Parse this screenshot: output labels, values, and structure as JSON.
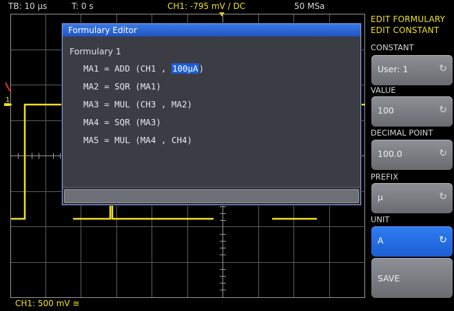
{
  "status_bar": {
    "timebase": "TB: 10 µs",
    "trigger_time": "T: 0 s",
    "ch1_trigger": "CH1: -795 mV / DC",
    "sample_rate": "50 MSa"
  },
  "bottom_bar": {
    "ch1_scale": "CH1: 500 mV ≅"
  },
  "channel_marker": "1",
  "menu": {
    "title_line1": "EDIT FORMULARY",
    "title_line2": "EDIT CONSTANT",
    "constant_label": "CONSTANT",
    "constant_value": "User: 1",
    "value_label": "VALUE",
    "value_value": "100",
    "decimal_label": "DECIMAL POINT",
    "decimal_value": "100.0",
    "prefix_label": "PREFIX",
    "prefix_value": "µ",
    "unit_label": "UNIT",
    "unit_value": "A",
    "save_label": "SAVE",
    "knob_icon": "rotary-knob-icon",
    "colors": {
      "active_key": "#1c5fd4",
      "inactive_key": "#7b7d82",
      "trace": "#f2e21b"
    }
  },
  "dialog": {
    "title": "Formulary Editor",
    "formulary_name": "Formulary 1",
    "lines": [
      {
        "prefix": "MA1 = ADD (CH1 , ",
        "highlight": "100µA",
        "suffix": ")"
      },
      {
        "prefix": "MA2 = SQR (MA1)",
        "highlight": "",
        "suffix": ""
      },
      {
        "prefix": "MA3 = MUL (CH3 , MA2)",
        "highlight": "",
        "suffix": ""
      },
      {
        "prefix": "MA4 = SQR (MA3)",
        "highlight": "",
        "suffix": ""
      },
      {
        "prefix": "MA5 = MUL (MA4 , CH4)",
        "highlight": "",
        "suffix": ""
      }
    ]
  }
}
